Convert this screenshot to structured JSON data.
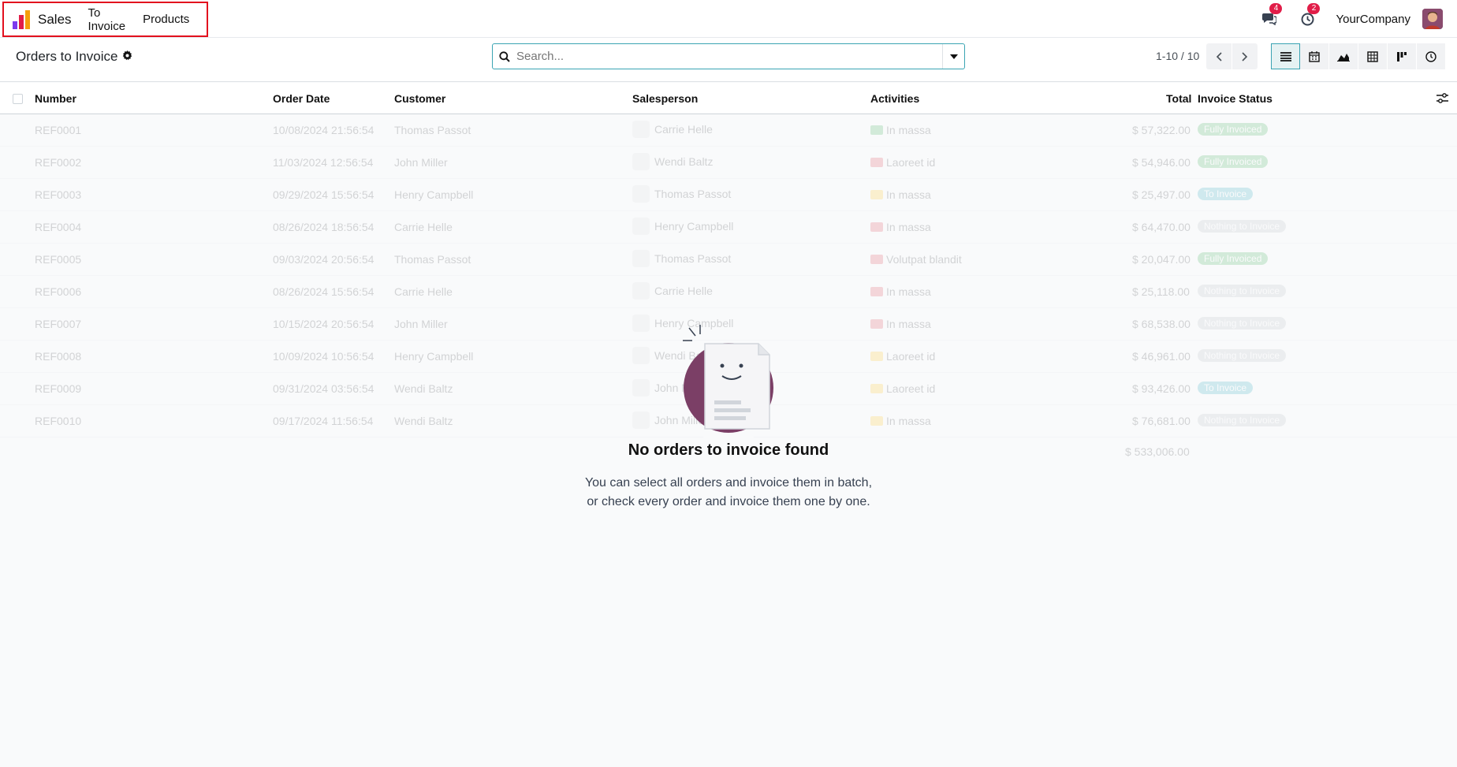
{
  "navbar": {
    "app_name": "Sales",
    "menu": [
      "To Invoice",
      "Products"
    ],
    "messages_count": "4",
    "activities_count": "2",
    "company": "YourCompany"
  },
  "control": {
    "breadcrumb": "Orders to Invoice",
    "search_placeholder": "Search...",
    "pager": "1-10 / 10"
  },
  "table": {
    "headers": [
      "Number",
      "Order Date",
      "Customer",
      "Salesperson",
      "Activities",
      "Total",
      "Invoice Status"
    ],
    "rows": [
      {
        "number": "REF0001",
        "date": "10/08/2024 21:56:54",
        "customer": "Thomas Passot",
        "salesperson": "Carrie Helle",
        "activity": "In massa",
        "act_color": "#28a745",
        "total": "$ 57,322.00",
        "status": "Fully Invoiced",
        "status_color": "#28a745"
      },
      {
        "number": "REF0002",
        "date": "11/03/2024 12:56:54",
        "customer": "John Miller",
        "salesperson": "Wendi Baltz",
        "activity": "Laoreet id",
        "act_color": "#dc3545",
        "total": "$ 54,946.00",
        "status": "Fully Invoiced",
        "status_color": "#28a745"
      },
      {
        "number": "REF0003",
        "date": "09/29/2024 15:56:54",
        "customer": "Henry Campbell",
        "salesperson": "Thomas Passot",
        "activity": "In massa",
        "act_color": "#ffc107",
        "total": "$ 25,497.00",
        "status": "To Invoice",
        "status_color": "#17a2b8"
      },
      {
        "number": "REF0004",
        "date": "08/26/2024 18:56:54",
        "customer": "Carrie Helle",
        "salesperson": "Henry Campbell",
        "activity": "In massa",
        "act_color": "#dc3545",
        "total": "$ 64,470.00",
        "status": "Nothing to Invoice",
        "status_color": "#adb5bd"
      },
      {
        "number": "REF0005",
        "date": "09/03/2024 20:56:54",
        "customer": "Thomas Passot",
        "salesperson": "Thomas Passot",
        "activity": "Volutpat blandit",
        "act_color": "#dc3545",
        "total": "$ 20,047.00",
        "status": "Fully Invoiced",
        "status_color": "#28a745"
      },
      {
        "number": "REF0006",
        "date": "08/26/2024 15:56:54",
        "customer": "Carrie Helle",
        "salesperson": "Carrie Helle",
        "activity": "In massa",
        "act_color": "#dc3545",
        "total": "$ 25,118.00",
        "status": "Nothing to Invoice",
        "status_color": "#adb5bd"
      },
      {
        "number": "REF0007",
        "date": "10/15/2024 20:56:54",
        "customer": "John Miller",
        "salesperson": "Henry Campbell",
        "activity": "In massa",
        "act_color": "#dc3545",
        "total": "$ 68,538.00",
        "status": "Nothing to Invoice",
        "status_color": "#adb5bd"
      },
      {
        "number": "REF0008",
        "date": "10/09/2024 10:56:54",
        "customer": "Henry Campbell",
        "salesperson": "Wendi Baltz",
        "activity": "Laoreet id",
        "act_color": "#ffc107",
        "total": "$ 46,961.00",
        "status": "Nothing to Invoice",
        "status_color": "#adb5bd"
      },
      {
        "number": "REF0009",
        "date": "09/31/2024 03:56:54",
        "customer": "Wendi Baltz",
        "salesperson": "John Miller",
        "activity": "Laoreet id",
        "act_color": "#ffc107",
        "total": "$ 93,426.00",
        "status": "To Invoice",
        "status_color": "#17a2b8"
      },
      {
        "number": "REF0010",
        "date": "09/17/2024 11:56:54",
        "customer": "Wendi Baltz",
        "salesperson": "John Miller",
        "activity": "In massa",
        "act_color": "#ffc107",
        "total": "$ 76,681.00",
        "status": "Nothing to Invoice",
        "status_color": "#adb5bd"
      }
    ],
    "sum_total": "$ 533,006.00"
  },
  "empty": {
    "title": "No orders to invoice found",
    "line1": "You can select all orders and invoice them in batch,",
    "line2": "or check every order and invoice them one by one."
  }
}
